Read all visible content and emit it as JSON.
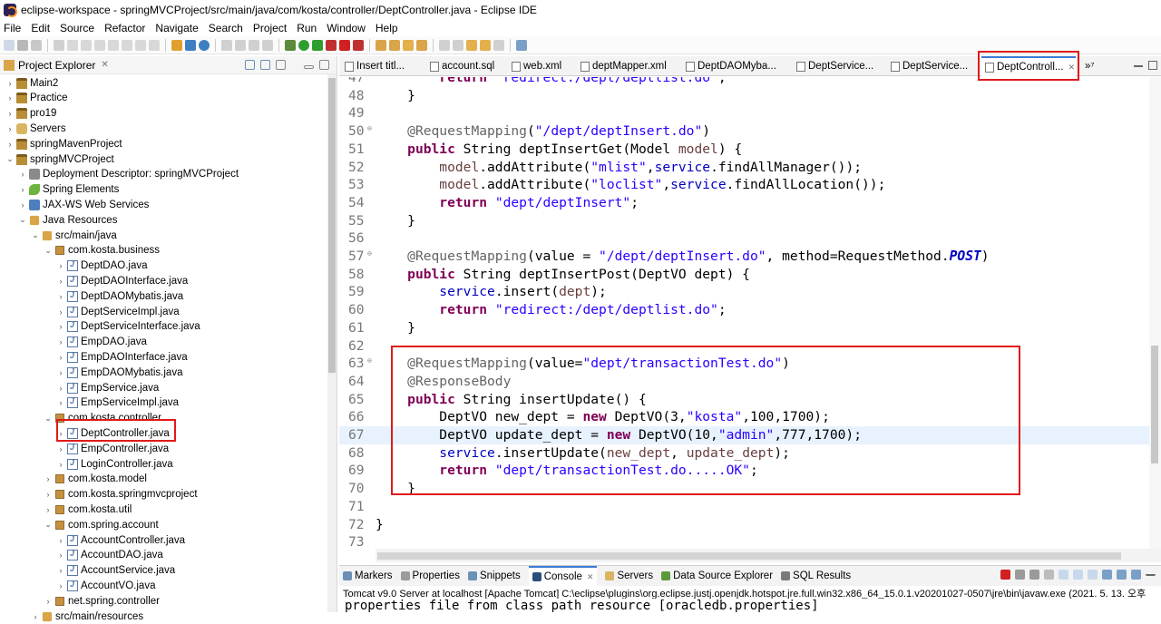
{
  "window": {
    "title": "eclipse-workspace - springMVCProject/src/main/java/com/kosta/controller/DeptController.java - Eclipse IDE"
  },
  "menu": [
    "File",
    "Edit",
    "Source",
    "Refactor",
    "Navigate",
    "Search",
    "Project",
    "Run",
    "Window",
    "Help"
  ],
  "explorer": {
    "title": "Project Explorer",
    "items": [
      {
        "label": "Main2",
        "icon": "project-icon"
      },
      {
        "label": "Practice",
        "icon": "project-icon"
      },
      {
        "label": "pro19",
        "icon": "project-icon"
      },
      {
        "label": "Servers",
        "icon": "server-folder-icon"
      },
      {
        "label": "springMavenProject",
        "icon": "project-icon"
      },
      {
        "label": "springMVCProject",
        "icon": "project-icon"
      },
      {
        "label": "Deployment Descriptor: springMVCProject",
        "icon": "descriptor-icon"
      },
      {
        "label": "Spring Elements",
        "icon": "spring-icon"
      },
      {
        "label": "JAX-WS Web Services",
        "icon": "webservice-icon"
      },
      {
        "label": "Java Resources",
        "icon": "java-resources-icon"
      },
      {
        "label": "src/main/java",
        "icon": "source-folder-icon"
      },
      {
        "label": "com.kosta.business",
        "icon": "package-icon"
      },
      {
        "label": "DeptDAO.java",
        "icon": "java-file-icon"
      },
      {
        "label": "DeptDAOInterface.java",
        "icon": "java-file-icon"
      },
      {
        "label": "DeptDAOMybatis.java",
        "icon": "java-file-icon"
      },
      {
        "label": "DeptServiceImpl.java",
        "icon": "java-file-icon"
      },
      {
        "label": "DeptServiceInterface.java",
        "icon": "java-file-icon"
      },
      {
        "label": "EmpDAO.java",
        "icon": "java-file-icon"
      },
      {
        "label": "EmpDAOInterface.java",
        "icon": "java-file-icon"
      },
      {
        "label": "EmpDAOMybatis.java",
        "icon": "java-file-icon"
      },
      {
        "label": "EmpService.java",
        "icon": "java-file-icon"
      },
      {
        "label": "EmpServiceImpl.java",
        "icon": "java-file-icon"
      },
      {
        "label": "com.kosta.controller",
        "icon": "package-icon"
      },
      {
        "label": "DeptController.java",
        "icon": "java-file-icon"
      },
      {
        "label": "EmpController.java",
        "icon": "java-file-icon"
      },
      {
        "label": "LoginController.java",
        "icon": "java-file-icon"
      },
      {
        "label": "com.kosta.model",
        "icon": "package-icon"
      },
      {
        "label": "com.kosta.springmvcproject",
        "icon": "package-icon"
      },
      {
        "label": "com.kosta.util",
        "icon": "package-icon"
      },
      {
        "label": "com.spring.account",
        "icon": "package-icon"
      },
      {
        "label": "AccountController.java",
        "icon": "java-file-icon"
      },
      {
        "label": "AccountDAO.java",
        "icon": "java-file-icon"
      },
      {
        "label": "AccountService.java",
        "icon": "java-file-icon"
      },
      {
        "label": "AccountVO.java",
        "icon": "java-file-icon"
      },
      {
        "label": "net.spring.controller",
        "icon": "package-icon"
      },
      {
        "label": "src/main/resources",
        "icon": "source-folder-icon"
      }
    ]
  },
  "editor": {
    "tabs": [
      "Insert titl...",
      "account.sql",
      "web.xml",
      "deptMapper.xml",
      "DeptDAOMyba...",
      "DeptService...",
      "DeptService...",
      "DeptControll..."
    ],
    "tabs_overflow": "»⁷",
    "lines": [
      {
        "n": "47",
        "t": "        return  redirect:/dept/deptlist.do ;"
      },
      {
        "n": "48",
        "t": "    }"
      },
      {
        "n": "49",
        "t": ""
      },
      {
        "n": "50",
        "t": "    @RequestMapping(\"/dept/deptInsert.do\")"
      },
      {
        "n": "51",
        "t": "    public String deptInsertGet(Model model) {"
      },
      {
        "n": "52",
        "t": "        model.addAttribute(\"mlist\",service.findAllManager());"
      },
      {
        "n": "53",
        "t": "        model.addAttribute(\"loclist\",service.findAllLocation());"
      },
      {
        "n": "54",
        "t": "        return \"dept/deptInsert\";"
      },
      {
        "n": "55",
        "t": "    }"
      },
      {
        "n": "56",
        "t": ""
      },
      {
        "n": "57",
        "t": "    @RequestMapping(value = \"/dept/deptInsert.do\", method=RequestMethod.POST)"
      },
      {
        "n": "58",
        "t": "    public String deptInsertPost(DeptVO dept) {"
      },
      {
        "n": "59",
        "t": "        service.insert(dept);"
      },
      {
        "n": "60",
        "t": "        return \"redirect:/dept/deptlist.do\";"
      },
      {
        "n": "61",
        "t": "    }"
      },
      {
        "n": "62",
        "t": ""
      },
      {
        "n": "63",
        "t": "    @RequestMapping(value=\"dept/transactionTest.do\")"
      },
      {
        "n": "64",
        "t": "    @ResponseBody"
      },
      {
        "n": "65",
        "t": "    public String insertUpdate() {"
      },
      {
        "n": "66",
        "t": "        DeptVO new_dept = new DeptVO(3,\"kosta\",100,1700);"
      },
      {
        "n": "67",
        "t": "        DeptVO update_dept = new DeptVO(10,\"admin\",777,1700);"
      },
      {
        "n": "68",
        "t": "        service.insertUpdate(new_dept, update_dept);"
      },
      {
        "n": "69",
        "t": "        return \"dept/transactionTest.do.....OK\";"
      },
      {
        "n": "70",
        "t": "    }"
      },
      {
        "n": "71",
        "t": ""
      },
      {
        "n": "72",
        "t": "}"
      },
      {
        "n": "73",
        "t": ""
      }
    ]
  },
  "console": {
    "tabs": [
      "Markers",
      "Properties",
      "Snippets",
      "Console",
      "Servers",
      "Data Source Explorer",
      "SQL Results"
    ],
    "info": "Tomcat v9.0 Server at localhost [Apache Tomcat] C:\\eclipse\\plugins\\org.eclipse.justj.openjdk.hotspot.jre.full.win32.x86_64_15.0.1.v20201027-0507\\jre\\bin\\javaw.exe  (2021. 5. 13. 오후",
    "output": "properties file from class path resource [oracledb.properties]"
  }
}
